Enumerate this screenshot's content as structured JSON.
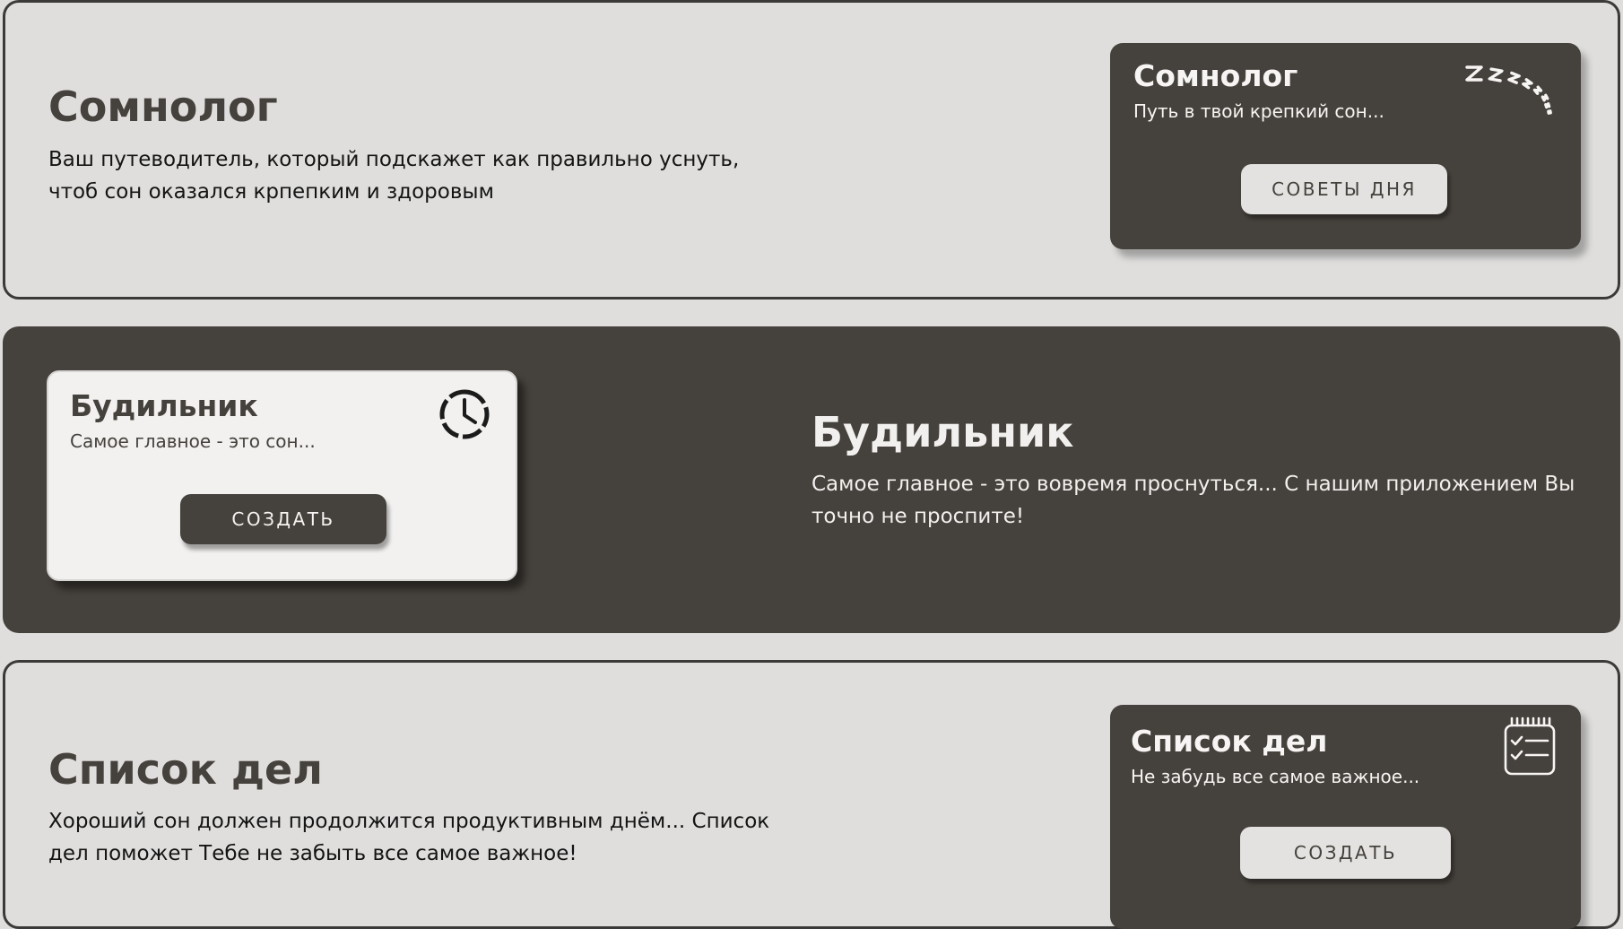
{
  "colors": {
    "page_background": "#dfdedd",
    "dark": "#45413c",
    "light_card": "#f2f1f0",
    "border": "#3b3a38"
  },
  "sections": [
    {
      "theme": "light",
      "title": "Сомнолог",
      "description": "Ваш путеводитель, который подскажет как правильно уснуть, чтоб сон оказался крпепким и здоровым",
      "card": {
        "title": "Сомнолог",
        "subtitle": "Путь в твой крепкий сон...",
        "icon": "sleep-zzz-icon",
        "button_label": "СОВЕТЫ ДНЯ"
      }
    },
    {
      "theme": "dark",
      "title": "Будильник",
      "description": "Самое главное - это вовремя проснуться... С нашим приложением Вы точно не проспите!",
      "card": {
        "title": "Будильник",
        "subtitle": "Самое главное - это сон...",
        "icon": "alarm-clock-icon",
        "button_label": "СОЗДАТЬ"
      }
    },
    {
      "theme": "light",
      "title": "Список дел",
      "description": "Хороший сон должен продолжится продуктивным днём... Список дел поможет Тебе не забыть все самое важное!",
      "card": {
        "title": "Список дел",
        "subtitle": "Не забудь все самое важное...",
        "icon": "checklist-notepad-icon",
        "button_label": "СОЗДАТЬ"
      }
    }
  ]
}
